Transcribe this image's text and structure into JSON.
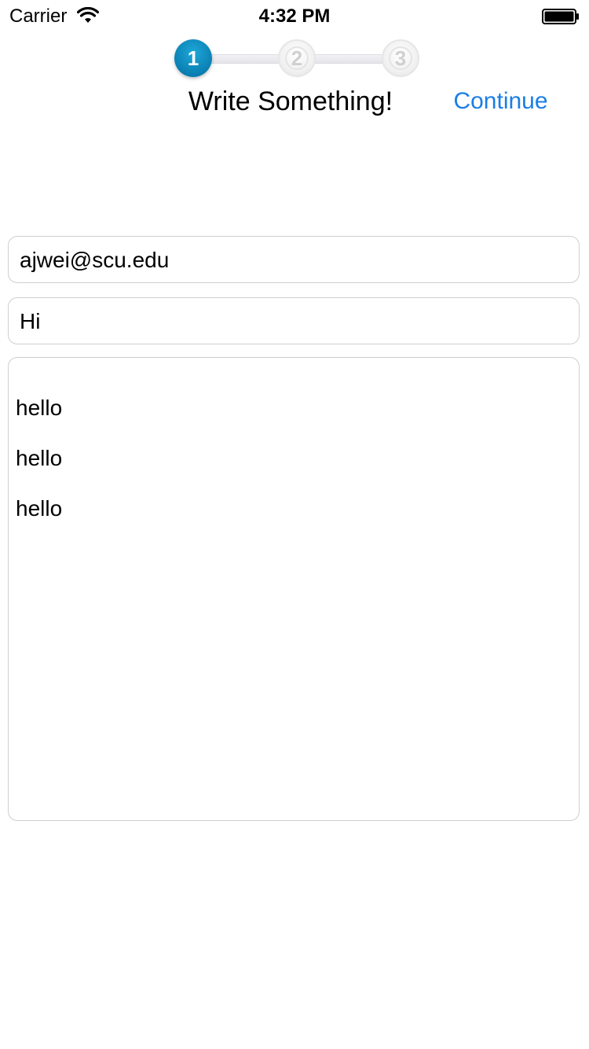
{
  "status_bar": {
    "carrier": "Carrier",
    "time": "4:32 PM",
    "wifi_icon": "wifi-icon",
    "battery_icon": "battery-full-icon"
  },
  "stepper": {
    "steps": [
      "1",
      "2",
      "3"
    ],
    "active_step": "1",
    "active_color": "#0a86bb"
  },
  "header": {
    "title": "Write Something!",
    "continue_label": "Continue",
    "accent_color": "#1a7ee6"
  },
  "form": {
    "email_value": "ajwei@scu.edu",
    "subject_value": "Hi",
    "message_lines": [
      "hello",
      "hello",
      "hello"
    ]
  }
}
